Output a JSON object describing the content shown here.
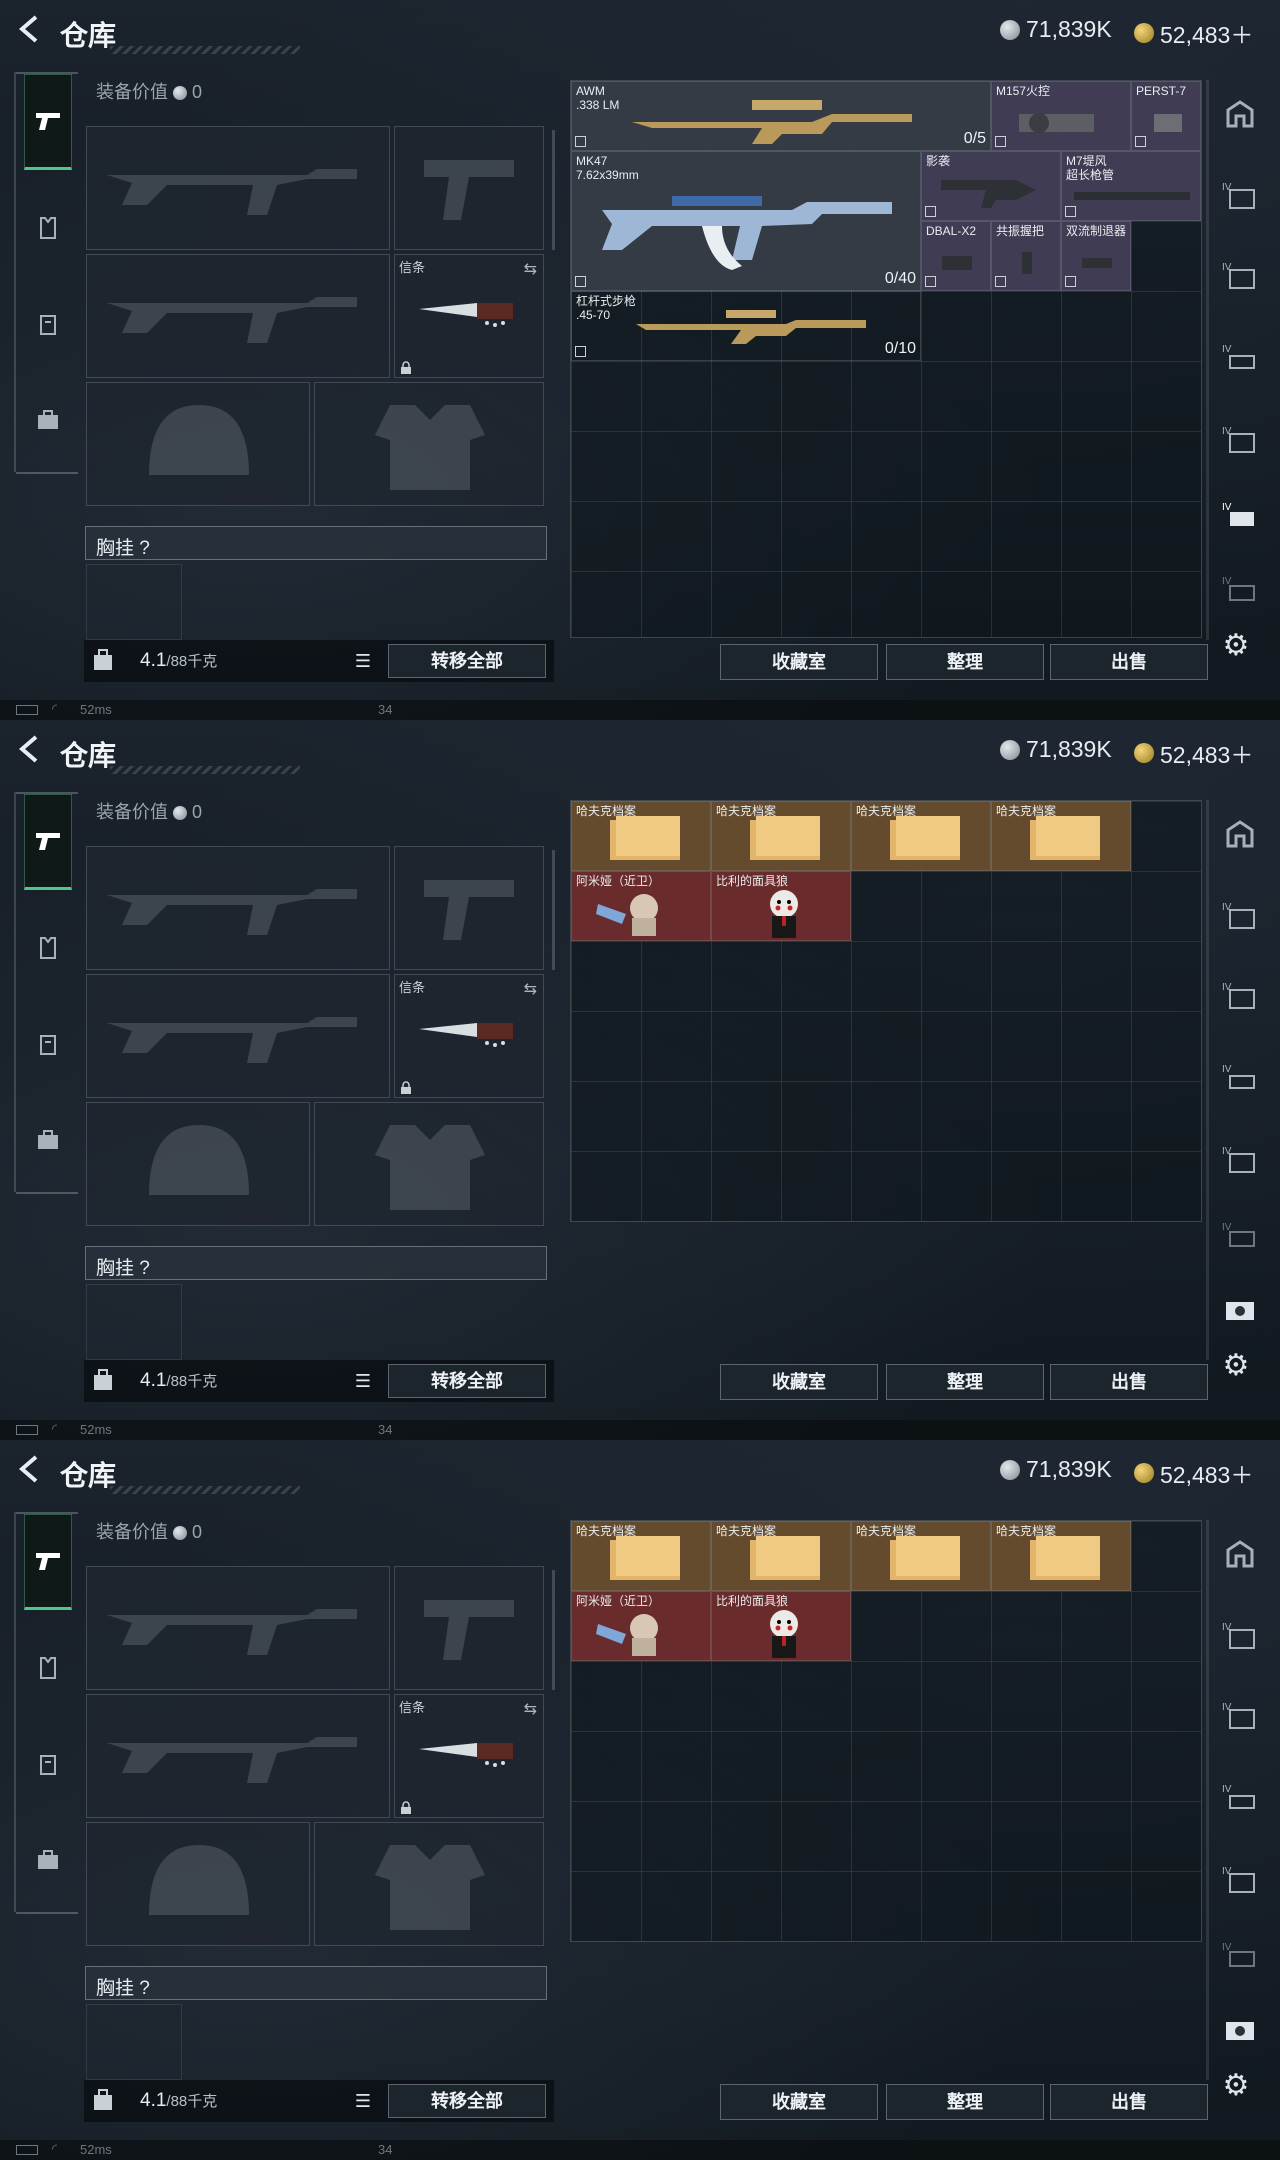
{
  "screens": [
    {
      "title": "仓库",
      "currency": {
        "silver": "71,839K",
        "gold": "52,483＋"
      },
      "equip_value_label": "装备价值",
      "equip_value": "0",
      "melee_slot_label": "信条",
      "chest_label": "胸挂  ?",
      "weight_current": "4.1",
      "weight_max": "/88千克",
      "transfer_all": "转移全部",
      "actions": [
        "收藏室",
        "整理",
        "出售"
      ],
      "status": {
        "ping": "52ms",
        "fps": "34"
      },
      "items": [
        {
          "name": "AWM\n.338 LM",
          "count": "0/5",
          "color": "gray"
        },
        {
          "name": "M157火控",
          "count": "",
          "color": "purple"
        },
        {
          "name": "PERST-7",
          "count": "",
          "color": "purple"
        },
        {
          "name": "MK47\n7.62x39mm",
          "count": "0/40",
          "color": "gray"
        },
        {
          "name": "影袭",
          "count": "",
          "color": "purple"
        },
        {
          "name": "M7堤风\n超长枪管",
          "count": "",
          "color": "purple"
        },
        {
          "name": "DBAL-X2",
          "count": "",
          "color": "purple"
        },
        {
          "name": "共振握把",
          "count": "",
          "color": "purple"
        },
        {
          "name": "双流制退器",
          "count": "",
          "color": "purple"
        },
        {
          "name": "杠杆式步枪\n.45-70",
          "count": "0/10",
          "color": "none"
        }
      ]
    },
    {
      "title": "仓库",
      "currency": {
        "silver": "71,839K",
        "gold": "52,483＋"
      },
      "equip_value_label": "装备价值",
      "equip_value": "0",
      "melee_slot_label": "信条",
      "chest_label": "胸挂  ?",
      "weight_current": "4.1",
      "weight_max": "/88千克",
      "transfer_all": "转移全部",
      "actions": [
        "收藏室",
        "整理",
        "出售"
      ],
      "status": {
        "ping": "52ms",
        "fps": "34"
      },
      "items": [
        {
          "name": "哈夫克档案",
          "color": "orange"
        },
        {
          "name": "哈夫克档案",
          "color": "orange"
        },
        {
          "name": "哈夫克档案",
          "color": "orange"
        },
        {
          "name": "哈夫克档案",
          "color": "orange"
        },
        {
          "name": "阿米娅（近卫）",
          "color": "red"
        },
        {
          "name": "比利的面具狼",
          "color": "red"
        }
      ]
    },
    {
      "title": "仓库",
      "currency": {
        "silver": "71,839K",
        "gold": "52,483＋"
      },
      "equip_value_label": "装备价值",
      "equip_value": "0",
      "melee_slot_label": "信条",
      "chest_label": "胸挂  ?",
      "weight_current": "4.1",
      "weight_max": "/88千克",
      "transfer_all": "转移全部",
      "actions": [
        "收藏室",
        "整理",
        "出售"
      ],
      "status": {
        "ping": "52ms",
        "fps": "34"
      },
      "items": [
        {
          "name": "哈夫克档案",
          "color": "orange"
        },
        {
          "name": "哈夫克档案",
          "color": "orange"
        },
        {
          "name": "哈夫克档案",
          "color": "orange"
        },
        {
          "name": "哈夫克档案",
          "color": "orange"
        },
        {
          "name": "阿米娅（近卫）",
          "color": "red"
        },
        {
          "name": "比利的面具狼",
          "color": "red"
        }
      ]
    }
  ]
}
